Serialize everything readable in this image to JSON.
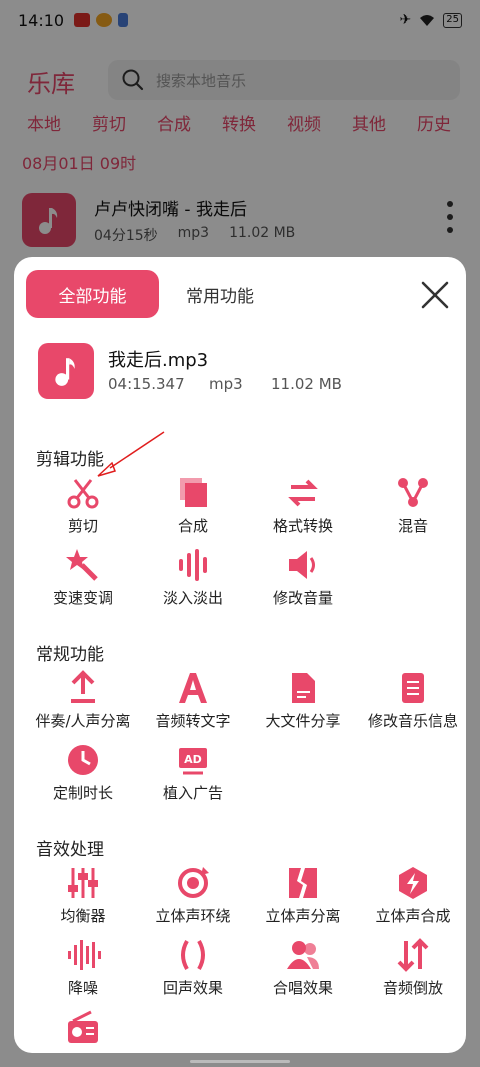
{
  "status": {
    "time": "14:10",
    "battery": "25"
  },
  "library": {
    "title": "乐库",
    "search_placeholder": "搜索本地音乐",
    "tabs": [
      "本地",
      "剪切",
      "合成",
      "转换",
      "视频",
      "其他",
      "历史"
    ],
    "date": "08月01日  09时",
    "song": {
      "title": "卢卢快闭嘴 - 我走后",
      "duration": "04分15秒",
      "format": "mp3",
      "size": "11.02 MB"
    }
  },
  "sheet": {
    "tab_all": "全部功能",
    "tab_common": "常用功能",
    "file": {
      "name": "我走后.mp3",
      "duration": "04:15.347",
      "format": "mp3",
      "size": "11.02 MB"
    },
    "sections": [
      {
        "title": "剪辑功能",
        "items": [
          {
            "label": "剪切",
            "icon": "scissors-icon"
          },
          {
            "label": "合成",
            "icon": "merge-icon"
          },
          {
            "label": "格式转换",
            "icon": "convert-icon"
          },
          {
            "label": "混音",
            "icon": "mix-icon"
          },
          {
            "label": "变速变调",
            "icon": "magic-wand-icon"
          },
          {
            "label": "淡入淡出",
            "icon": "fade-icon"
          },
          {
            "label": "修改音量",
            "icon": "volume-icon"
          }
        ]
      },
      {
        "title": "常规功能",
        "items": [
          {
            "label": "伴奏/人声分离",
            "icon": "upload-icon"
          },
          {
            "label": "音频转文字",
            "icon": "text-icon"
          },
          {
            "label": "大文件分享",
            "icon": "file-share-icon"
          },
          {
            "label": "修改音乐信息",
            "icon": "document-icon"
          },
          {
            "label": "定制时长",
            "icon": "clock-icon"
          },
          {
            "label": "植入广告",
            "icon": "ad-icon"
          }
        ]
      },
      {
        "title": "音效处理",
        "items": [
          {
            "label": "均衡器",
            "icon": "equalizer-icon"
          },
          {
            "label": "立体声环绕",
            "icon": "surround-icon"
          },
          {
            "label": "立体声分离",
            "icon": "split-icon"
          },
          {
            "label": "立体声合成",
            "icon": "stereo-merge-icon"
          },
          {
            "label": "降噪",
            "icon": "noise-reduction-icon"
          },
          {
            "label": "回声效果",
            "icon": "echo-icon"
          },
          {
            "label": "合唱效果",
            "icon": "chorus-icon"
          },
          {
            "label": "音频倒放",
            "icon": "reverse-icon"
          },
          {
            "label": "",
            "icon": "radio-icon"
          }
        ]
      }
    ]
  },
  "colors": {
    "accent": "#e8486a",
    "annotation": "#e01e1e"
  }
}
